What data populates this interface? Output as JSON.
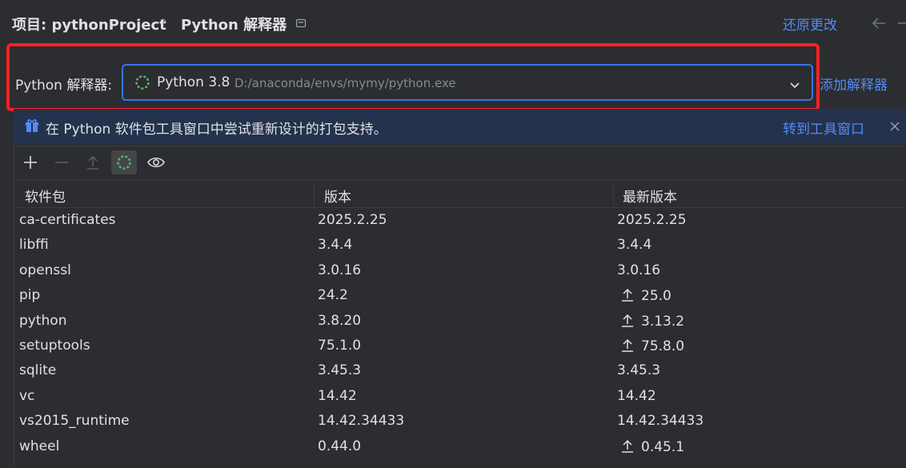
{
  "header": {
    "project_crumb": "项目: pythonProject",
    "separator": "›",
    "page_crumb": "Python 解释器",
    "revert_label": "还原更改"
  },
  "interpreter": {
    "label": "Python 解释器:",
    "selected_name": "Python 3.8",
    "selected_path": "D:/anaconda/envs/mymy/python.exe",
    "add_label": "添加解释器"
  },
  "banner": {
    "text": "在 Python 软件包工具窗口中尝试重新设计的打包支持。",
    "link": "转到工具窗口"
  },
  "toolbar": {
    "icons": [
      "add-icon",
      "remove-icon",
      "upgrade-icon",
      "loading-icon",
      "eye-icon"
    ]
  },
  "table": {
    "columns": [
      "软件包",
      "版本",
      "最新版本"
    ],
    "rows": [
      {
        "name": "ca-certificates",
        "version": "2025.2.25",
        "latest": "2025.2.25",
        "upgrade": false
      },
      {
        "name": "libffi",
        "version": "3.4.4",
        "latest": "3.4.4",
        "upgrade": false
      },
      {
        "name": "openssl",
        "version": "3.0.16",
        "latest": "3.0.16",
        "upgrade": false
      },
      {
        "name": "pip",
        "version": "24.2",
        "latest": "25.0",
        "upgrade": true
      },
      {
        "name": "python",
        "version": "3.8.20",
        "latest": "3.13.2",
        "upgrade": true
      },
      {
        "name": "setuptools",
        "version": "75.1.0",
        "latest": "75.8.0",
        "upgrade": true
      },
      {
        "name": "sqlite",
        "version": "3.45.3",
        "latest": "3.45.3",
        "upgrade": false
      },
      {
        "name": "vc",
        "version": "14.42",
        "latest": "14.42",
        "upgrade": false
      },
      {
        "name": "vs2015_runtime",
        "version": "14.42.34433",
        "latest": "14.42.34433",
        "upgrade": false
      },
      {
        "name": "wheel",
        "version": "0.44.0",
        "latest": "0.45.1",
        "upgrade": true
      }
    ]
  },
  "colors": {
    "accent": "#548af7",
    "focus_border": "#3574f0",
    "highlight_box": "#ff2020",
    "spinner": "#5fb865"
  }
}
